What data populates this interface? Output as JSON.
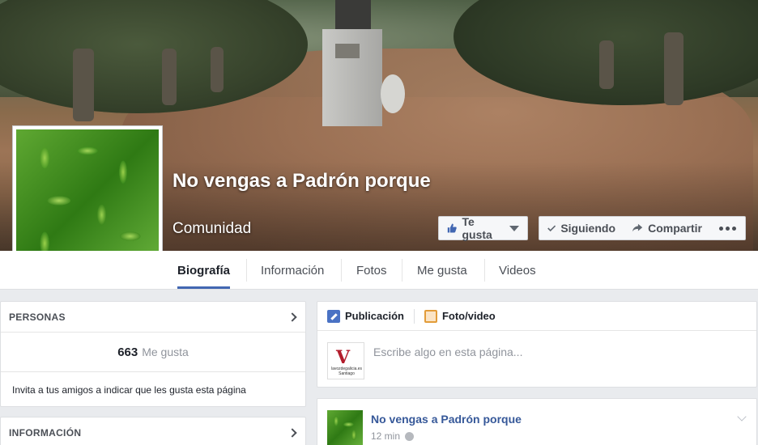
{
  "page": {
    "name": "No vengas a Padrón porque",
    "category": "Comunidad"
  },
  "cover_buttons": {
    "like": "Te gusta",
    "following": "Siguiendo",
    "share": "Compartir"
  },
  "tabs": [
    {
      "label": "Biografía",
      "active": true
    },
    {
      "label": "Información"
    },
    {
      "label": "Fotos"
    },
    {
      "label": "Me gusta"
    },
    {
      "label": "Videos"
    }
  ],
  "people": {
    "title": "PERSONAS",
    "count": "663",
    "count_label": "Me gusta",
    "invite_text": "Invita a tus amigos a indicar que les gusta esta página"
  },
  "info": {
    "title": "INFORMACIÓN"
  },
  "composer": {
    "tab_post": "Publicación",
    "tab_photo": "Foto/video",
    "placeholder": "Escribe algo en esta página...",
    "avatar_caption": "lavozdegalicia.es Santiago"
  },
  "post": {
    "author": "No vengas a Padrón porque",
    "time": "12 min"
  },
  "colors": {
    "accent": "#4267b2",
    "link": "#365899",
    "background": "#e9ebee"
  },
  "icons": [
    "thumbs-up-icon",
    "check-icon",
    "share-arrow-icon",
    "more-dots-icon",
    "chevron-right-icon",
    "pencil-icon",
    "photo-icon",
    "globe-icon",
    "chevron-down-icon"
  ]
}
